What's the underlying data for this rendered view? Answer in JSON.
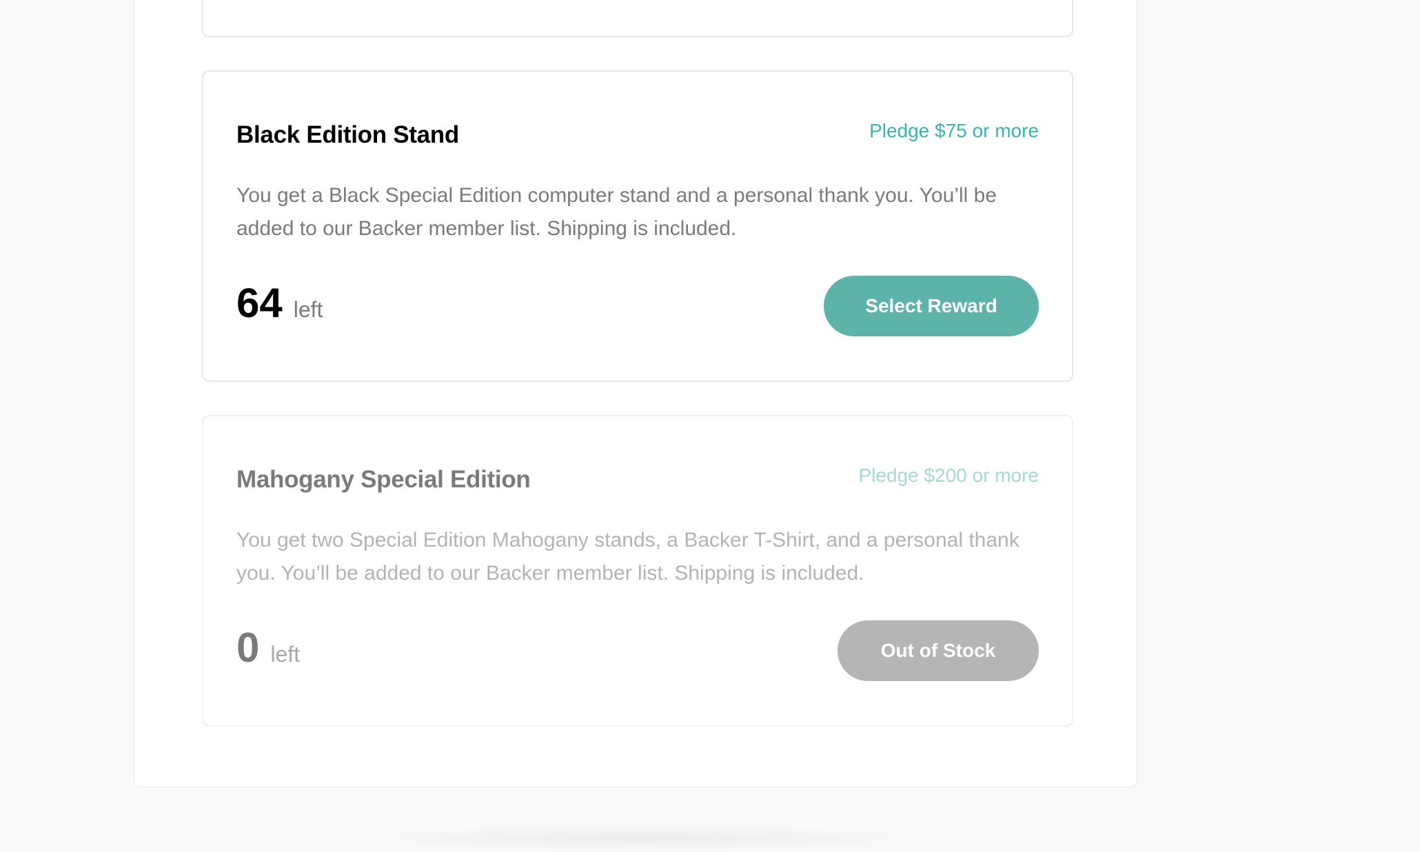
{
  "rewards": [
    {
      "title": "Black Edition Stand",
      "pledge": "Pledge $75 or more",
      "description": "You get a Black Special Edition computer stand and a personal thank you. You’ll be added to our Backer member list. Shipping is included.",
      "left_count": "64",
      "left_label": "left",
      "button_label": "Select Reward"
    },
    {
      "title": "Mahogany Special Edition",
      "pledge": "Pledge $200 or more",
      "description": "You get two Special Edition Mahogany stands, a Backer T-Shirt, and a personal thank you. You’ll be added to our Backer member list. Shipping is included.",
      "left_count": "0",
      "left_label": "left",
      "button_label": "Out of Stock"
    }
  ],
  "colors": {
    "accent": "#3cb3ab",
    "button_primary": "#5db3aa",
    "button_disabled": "#b5b5b5",
    "page_background": "#f8f9fb"
  }
}
